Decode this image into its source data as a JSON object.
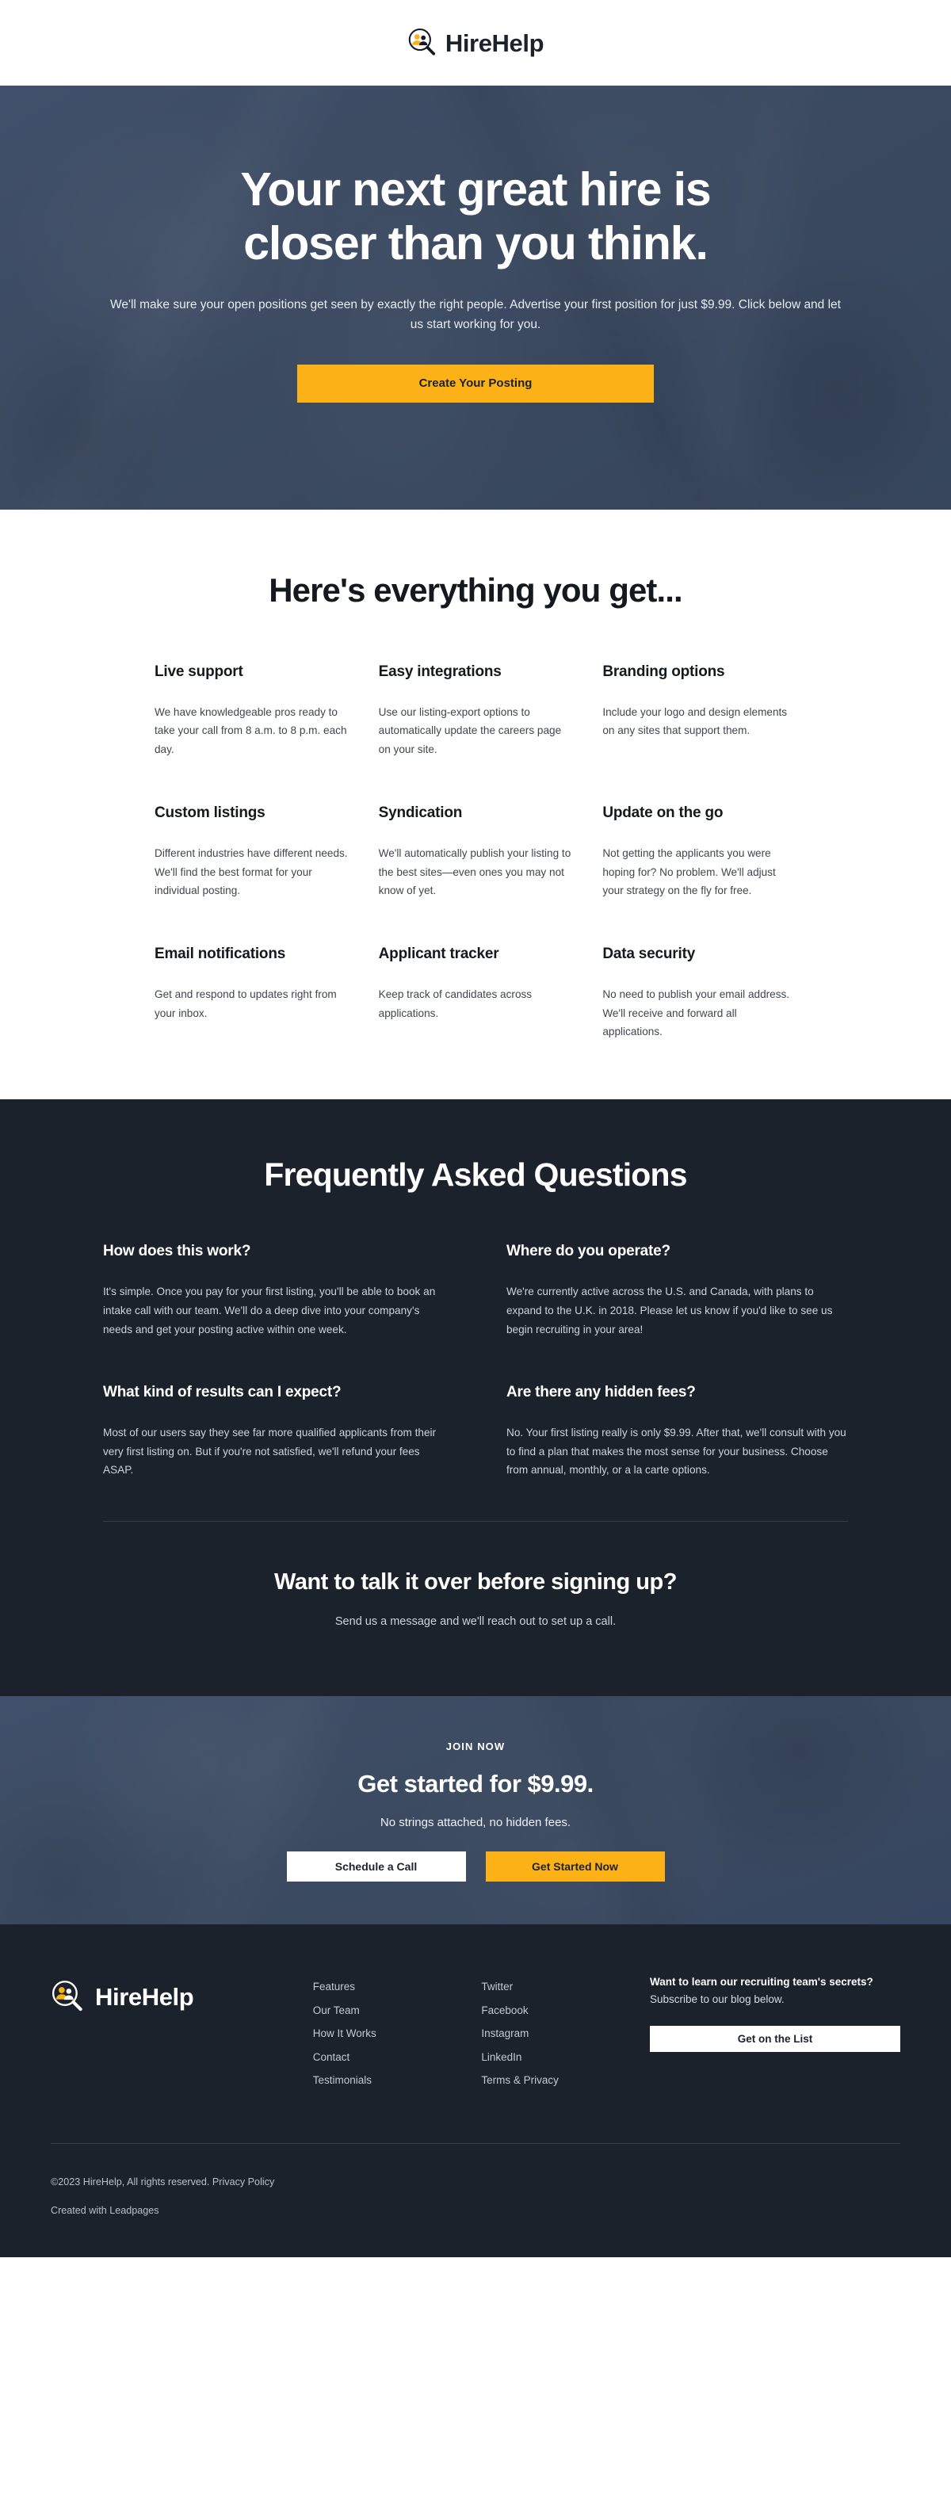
{
  "brand": {
    "name": "HireHelp",
    "logo_icon": "magnifier-people-icon",
    "accent_color": "#fcb116",
    "dark_color": "#1b222c",
    "hero_color": "#3d4c63"
  },
  "hero": {
    "title_line1": "Your next great hire is",
    "title_line2": "closer than you think.",
    "subtitle": "We'll make sure your open positions get seen by exactly the right people. Advertise your first position for just $9.99. Click below and let us start working for you.",
    "cta_label": "Create Your Posting"
  },
  "features": {
    "heading": "Here's everything you get...",
    "items": [
      {
        "title": "Live support",
        "body": "We have knowledgeable pros ready to take your call from 8 a.m. to 8 p.m. each day."
      },
      {
        "title": "Easy integrations",
        "body": "Use our listing-export options to automatically update the careers page on your site."
      },
      {
        "title": "Branding options",
        "body": "Include your logo and design elements on any sites that support them."
      },
      {
        "title": "Custom listings",
        "body": "Different industries have different needs. We'll find the best format for your individual posting."
      },
      {
        "title": "Syndication",
        "body": "We'll automatically publish your listing to the best sites—even ones you may not know of yet."
      },
      {
        "title": "Update on the go",
        "body": "Not getting the applicants you were hoping for? No problem. We'll adjust your strategy on the fly for free."
      },
      {
        "title": "Email notifications",
        "body": "Get and respond to updates right from your inbox."
      },
      {
        "title": "Applicant tracker",
        "body": "Keep track of candidates across applications."
      },
      {
        "title": "Data security",
        "body": "No need to publish your email address. We'll receive and forward all applications."
      }
    ]
  },
  "faq": {
    "heading": "Frequently Asked Questions",
    "items": [
      {
        "question": "How does this work?",
        "answer": "It's simple. Once you pay for your first listing, you'll be able to book an intake call with our team. We'll do a deep dive into your company's needs and get your posting active within one week."
      },
      {
        "question": "Where do you operate?",
        "answer": "We're currently active across the U.S. and Canada, with plans to expand to the U.K. in 2018. Please let us know if you'd like to see us begin recruiting in your area!"
      },
      {
        "question": "What kind of results can I expect?",
        "answer": "Most of our users say they see far more qualified applicants from their very first listing on. But if you're not satisfied, we'll refund your fees ASAP."
      },
      {
        "question": "Are there any hidden fees?",
        "answer": "No. Your first listing really is only $9.99. After that, we'll consult with you to find a plan that makes the most sense for your business. Choose from annual, monthly, or a la carte options."
      }
    ],
    "talk_title": "Want to talk it over before signing up?",
    "talk_sub": "Send us a message and we'll reach out to set up a call."
  },
  "cta": {
    "eyebrow": "JOIN NOW",
    "title": "Get started for $9.99.",
    "subtitle": "No strings attached, no hidden fees.",
    "secondary_label": "Schedule a Call",
    "primary_label": "Get Started Now"
  },
  "footer": {
    "brand_name": "HireHelp",
    "nav_links": [
      "Features",
      "Our Team",
      "How It Works",
      "Contact",
      "Testimonials"
    ],
    "social_links": [
      "Twitter",
      "Facebook",
      "Instagram",
      "LinkedIn",
      "Terms & Privacy"
    ],
    "subscribe_strong": "Want to learn our recruiting team's secrets?",
    "subscribe_rest": " Subscribe to our blog below.",
    "subscribe_button": "Get on the List",
    "copyright": "©2023 HireHelp, All rights reserved. ",
    "privacy_policy": "Privacy Policy",
    "created_with": "Created with Leadpages"
  }
}
